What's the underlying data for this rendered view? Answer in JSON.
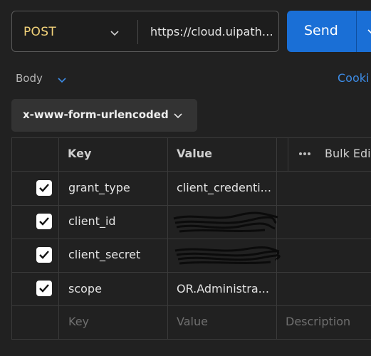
{
  "request": {
    "method": "POST",
    "url": "https://cloud.uipath.c...",
    "send_label": "Send"
  },
  "tabs": {
    "body_label": "Body",
    "cookies_label": "Cooki"
  },
  "body": {
    "encoding": "x-www-form-urlencoded"
  },
  "table": {
    "headers": {
      "key": "Key",
      "value": "Value",
      "bulk_edit": "Bulk Edi"
    },
    "rows": [
      {
        "checked": true,
        "key": "grant_type",
        "value": "client_credenti..."
      },
      {
        "checked": true,
        "key": "client_id",
        "value": "",
        "redacted": true
      },
      {
        "checked": true,
        "key": "client_secret",
        "value": "",
        "redacted": true
      },
      {
        "checked": true,
        "key": "scope",
        "value": "OR.Administra..."
      }
    ],
    "placeholders": {
      "key": "Key",
      "value": "Value",
      "description": "Description"
    }
  },
  "colors": {
    "background": "#212121",
    "method": "#f3d37a",
    "send": "#1a6fd6",
    "link": "#3d8ce6"
  }
}
